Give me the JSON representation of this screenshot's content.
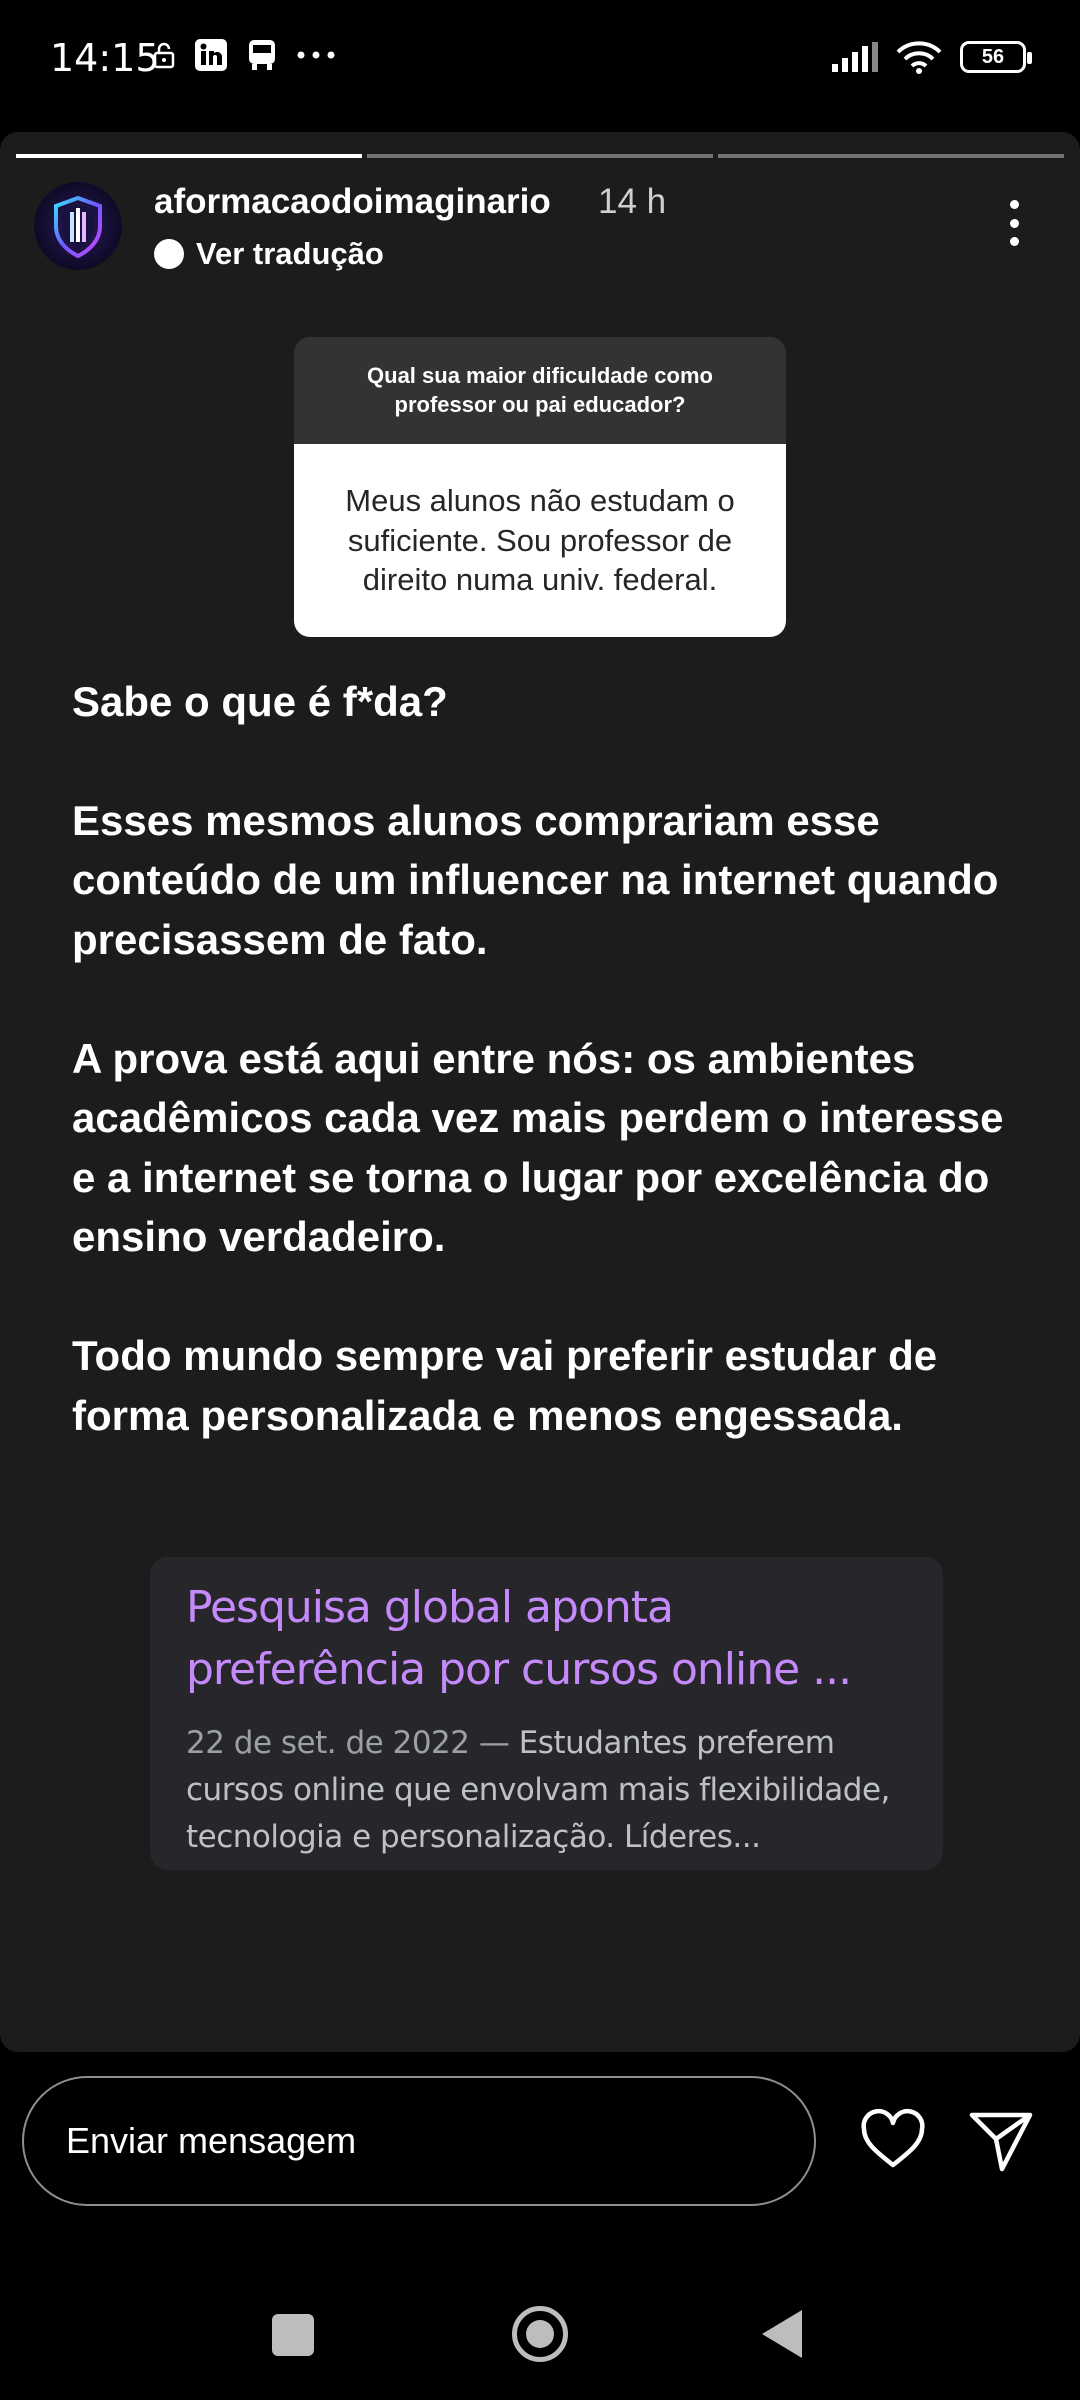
{
  "status_bar": {
    "time": "14:15",
    "battery": "56",
    "icons_left": [
      "lock-icon",
      "linkedin-icon",
      "bus-icon",
      "more-dots-icon"
    ],
    "icons_right": [
      "signal-icon",
      "wifi-icon",
      "battery-icon"
    ]
  },
  "story": {
    "progress": {
      "segments_total": 3,
      "segments_done": 1
    },
    "username": "aformacaodoimaginario",
    "time_ago": "14 h",
    "translate_label": "Ver tradução",
    "question": {
      "prompt": "Qual sua maior dificuldade como professor ou pai educador?",
      "answer": "Meus alunos não estudam o suficiente. Sou professor de direito numa univ. federal."
    },
    "paragraphs": [
      "Sabe o que é f*da?",
      "Esses mesmos alunos comprariam esse conteúdo de um influencer na internet quando precisassem de fato.",
      "A prova está aqui entre nós: os ambientes acadêmicos cada vez mais perdem o interesse e a internet se torna o lugar por excelência do ensino verdadeiro.",
      "Todo mundo sempre vai preferir estudar de forma personalizada e menos engessada."
    ],
    "link_card": {
      "title": "Pesquisa global aponta preferência por cursos online ...",
      "date": "22 de set. de 2022 — ",
      "description": "Estudantes preferem cursos online que envolvam mais flexibilidade, tecnologia e personalização. Líderes..."
    }
  },
  "reply_bar": {
    "placeholder": "Enviar mensagem"
  },
  "colors": {
    "story_background": "#1c1c1c",
    "link_title": "#c58af9",
    "link_card_background": "#27272b"
  }
}
